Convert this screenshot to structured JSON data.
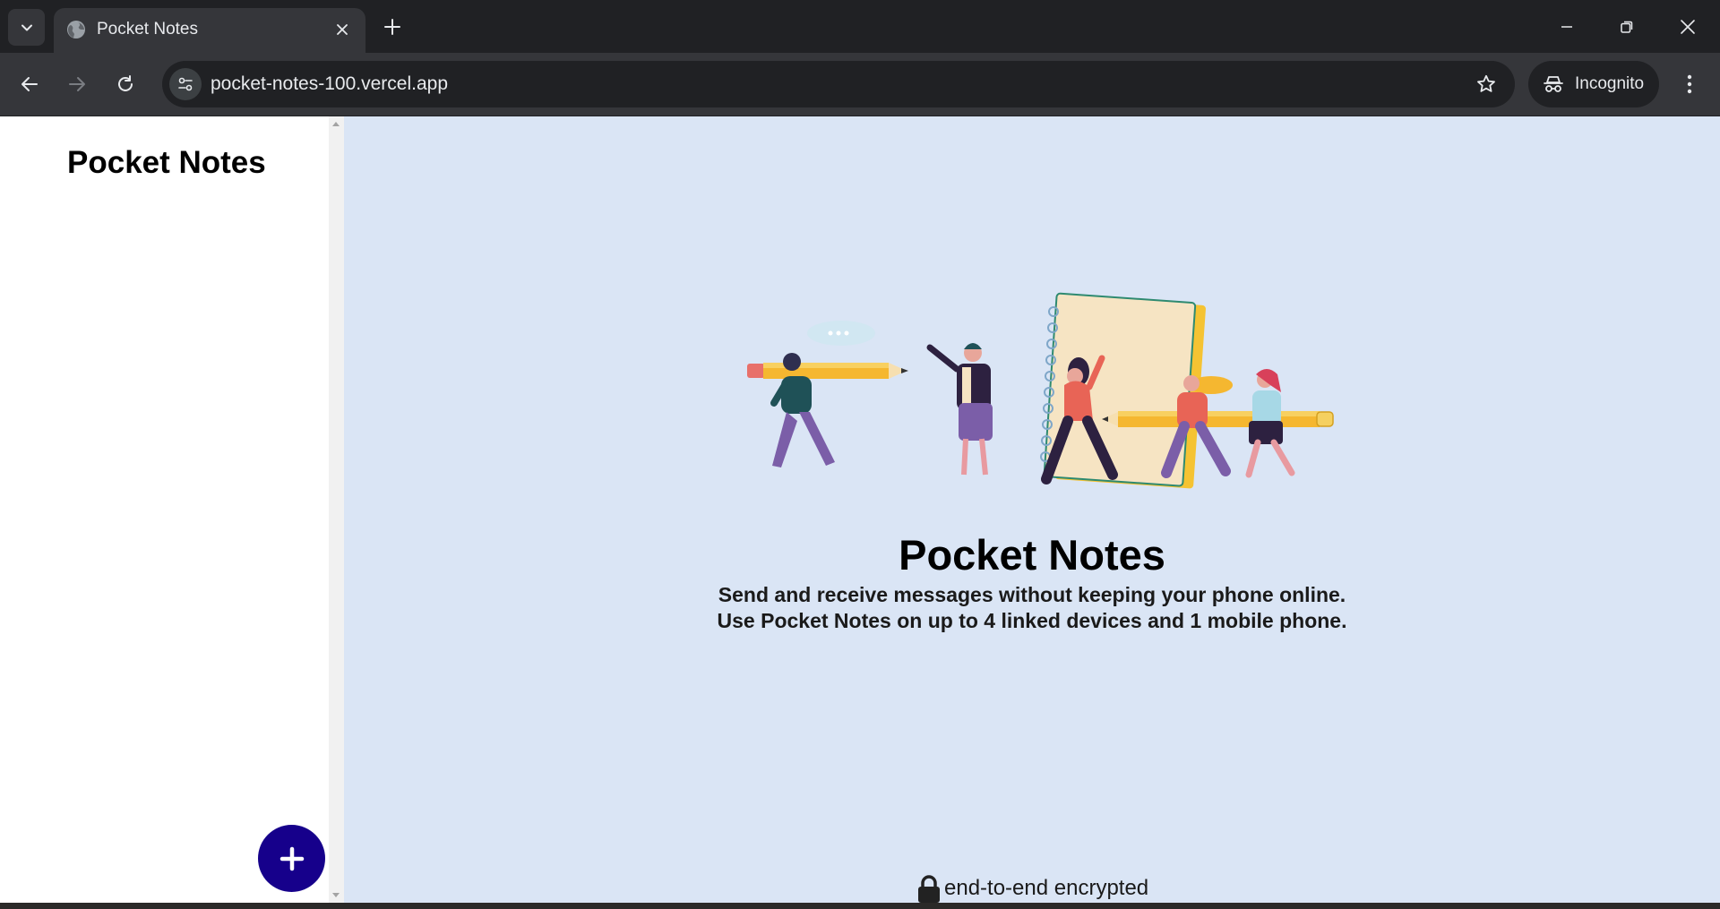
{
  "browser": {
    "tab": {
      "title": "Pocket Notes",
      "favicon": "globe-icon"
    },
    "address_bar": {
      "url": "pocket-notes-100.vercel.app"
    },
    "profile": {
      "label": "Incognito"
    }
  },
  "sidebar": {
    "title": "Pocket Notes",
    "add_button_icon": "plus-icon"
  },
  "main": {
    "title": "Pocket Notes",
    "description_lines": [
      "Send and receive messages without keeping your phone online.",
      "Use Pocket Notes on up to 4 linked devices and 1 mobile phone."
    ],
    "footer": {
      "icon": "lock-icon",
      "text": "end-to-end encrypted"
    }
  },
  "colors": {
    "main_background": "#dae5f5",
    "sidebar_background": "#ffffff",
    "add_button": "#16008b",
    "chrome_dark": "#202124",
    "chrome_toolbar": "#35363a"
  }
}
